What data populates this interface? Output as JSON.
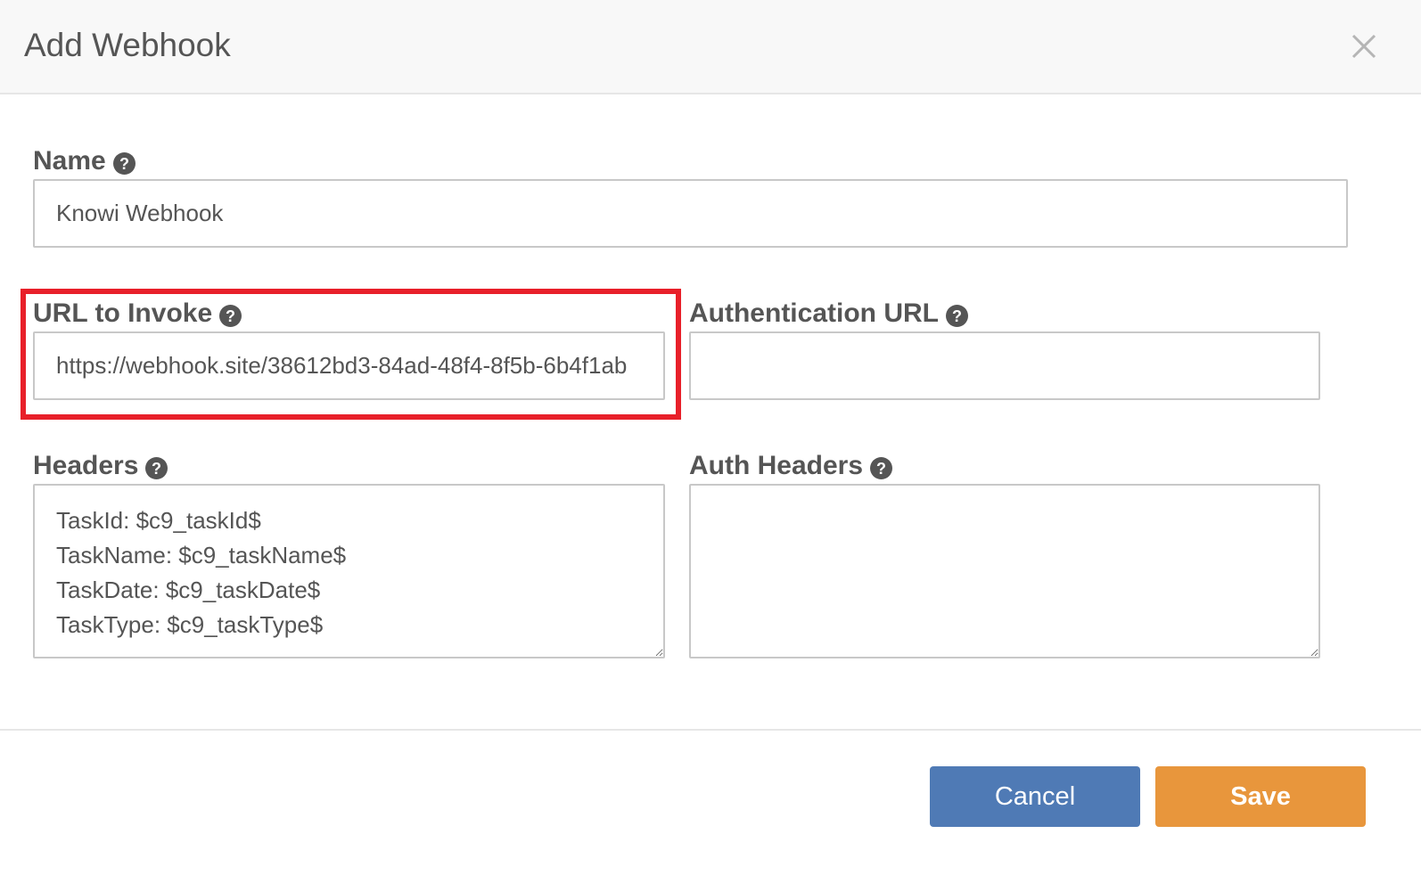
{
  "dialog": {
    "title": "Add Webhook"
  },
  "icons": {
    "close": "close-icon",
    "help": "question-circle-icon"
  },
  "form": {
    "name": {
      "label": "Name",
      "value": "Knowi Webhook"
    },
    "url_to_invoke": {
      "label": "URL to Invoke",
      "value": "https://webhook.site/38612bd3-84ad-48f4-8f5b-6b4f1ab"
    },
    "authentication_url": {
      "label": "Authentication URL",
      "value": ""
    },
    "headers": {
      "label": "Headers",
      "value": "TaskId: $c9_taskId$\nTaskName: $c9_taskName$\nTaskDate: $c9_taskDate$\nTaskType: $c9_taskType$"
    },
    "auth_headers": {
      "label": "Auth Headers",
      "value": ""
    }
  },
  "footer": {
    "cancel_label": "Cancel",
    "save_label": "Save"
  },
  "colors": {
    "cancel_button": "#4f7ab5",
    "save_button": "#e8963c",
    "highlight": "#e8202a"
  }
}
